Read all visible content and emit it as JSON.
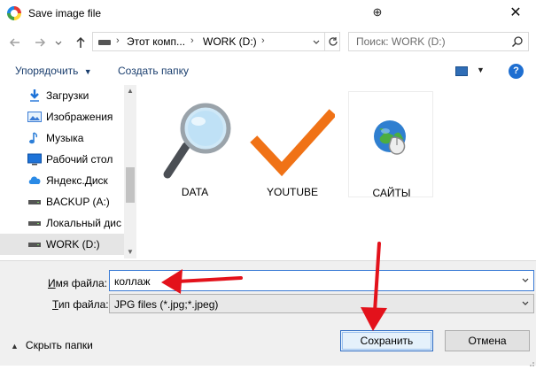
{
  "window": {
    "title": "Save image file",
    "help_glyph": "⊕",
    "close_glyph": "✕"
  },
  "navigation": {
    "back_icon": "arrow-left-icon",
    "forward_icon": "arrow-right-icon",
    "up_icon": "arrow-up-icon",
    "breadcrumb": [
      "Этот комп...",
      "WORK (D:)"
    ],
    "search_placeholder": "Поиск: WORK (D:)"
  },
  "toolbar": {
    "organize_label": "Упорядочить",
    "new_folder_label": "Создать папку",
    "help_label": "?"
  },
  "sidebar": {
    "items": [
      {
        "label": "Загрузки",
        "icon": "download-icon"
      },
      {
        "label": "Изображения",
        "icon": "pictures-icon"
      },
      {
        "label": "Музыка",
        "icon": "music-icon"
      },
      {
        "label": "Рабочий стол",
        "icon": "desktop-icon"
      },
      {
        "label": "Яндекс.Диск",
        "icon": "cloud-icon"
      },
      {
        "label": "BACKUP (A:)",
        "icon": "drive-icon"
      },
      {
        "label": "Локальный дис",
        "icon": "drive-icon"
      },
      {
        "label": "WORK (D:)",
        "icon": "drive-icon",
        "selected": true
      }
    ]
  },
  "content": {
    "folders": [
      {
        "label": "DATA",
        "icon": "magnifier-icon"
      },
      {
        "label": "YOUTUBE",
        "icon": "checkmark-icon"
      },
      {
        "label": "САЙТЫ",
        "icon": "globe-mouse-icon"
      }
    ]
  },
  "form": {
    "filename_label_prefix": "И",
    "filename_label_rest": "мя файла:",
    "filename_value": "коллаж",
    "filetype_label_prefix": "Т",
    "filetype_label_rest": "ип файла:",
    "filetype_value": "JPG files (*.jpg;*.jpeg)"
  },
  "buttons": {
    "hide_folders_label": "Скрыть папки",
    "save_label": "Сохранить",
    "cancel_label": "Отмена"
  },
  "colors": {
    "accent": "#3a7bd5",
    "annotation_arrow": "#e3121b",
    "link_text": "#1a3e6e"
  }
}
